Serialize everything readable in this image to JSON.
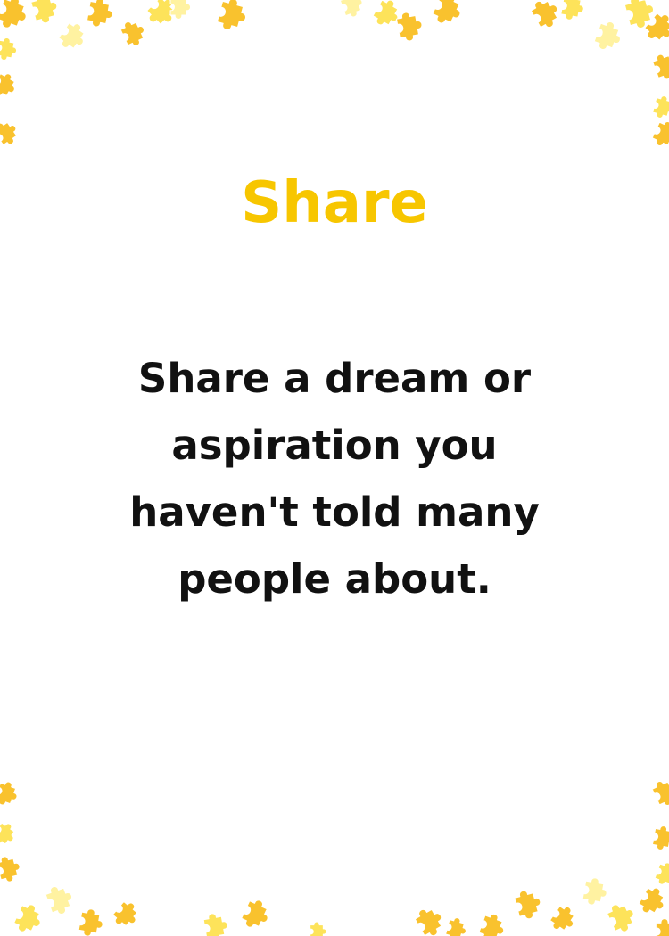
{
  "card": {
    "title": "Share",
    "prompt": "Share a dream or aspiration you haven't told many people about."
  },
  "colors": {
    "title": "#f7c600",
    "text": "#111111",
    "background": "#ffffff",
    "puzzle_gold": "#f9c22e",
    "puzzle_yellow": "#fde35a",
    "puzzle_pale": "#fff2a1"
  },
  "decoration": {
    "icon": "puzzle-piece-icon",
    "placement": "scattered along top and bottom borders"
  }
}
